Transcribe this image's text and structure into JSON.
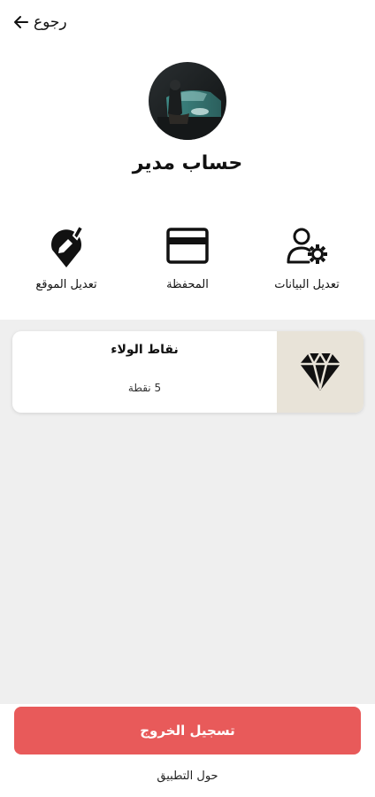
{
  "header": {
    "back_label": "رجوع",
    "back_icon": "arrow-left-icon"
  },
  "profile": {
    "avatar": "avatar-photo",
    "name": "حساب مدير"
  },
  "actions": [
    {
      "label": "تعديل البيانات",
      "icon": "user-gear-icon"
    },
    {
      "label": "المحفظة",
      "icon": "credit-card-icon"
    },
    {
      "label": "تعديل الموقع",
      "icon": "location-pin-edit-icon"
    }
  ],
  "loyalty": {
    "title": "نقاط الولاء",
    "value": "5 نقطة",
    "icon": "diamond-icon"
  },
  "footer": {
    "logout_label": "تسجيل الخروج",
    "about_label": "حول التطبيق"
  },
  "colors": {
    "logout_button": "#e85a5a",
    "loyalty_icon_bg": "#e8e3d8",
    "content_bg": "#efefef"
  }
}
